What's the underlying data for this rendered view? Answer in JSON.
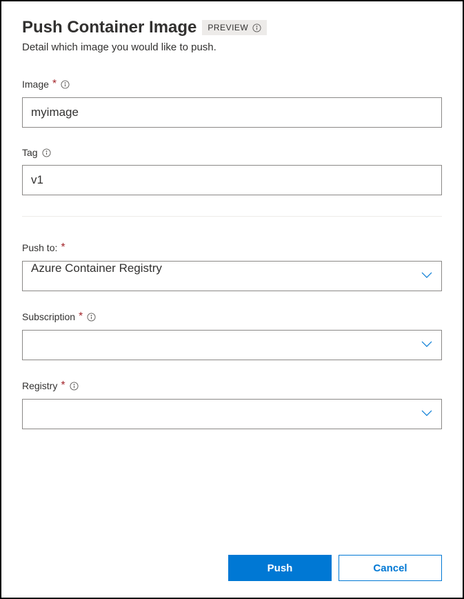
{
  "header": {
    "title": "Push Container Image",
    "preview_badge": "PREVIEW",
    "subtitle": "Detail which image you would like to push."
  },
  "fields": {
    "image": {
      "label": "Image",
      "value": "myimage"
    },
    "tag": {
      "label": "Tag",
      "value": "v1"
    },
    "push_to": {
      "label": "Push to:",
      "value": "Azure Container Registry"
    },
    "subscription": {
      "label": "Subscription",
      "value": ""
    },
    "registry": {
      "label": "Registry",
      "value": ""
    }
  },
  "buttons": {
    "primary": "Push",
    "secondary": "Cancel"
  }
}
